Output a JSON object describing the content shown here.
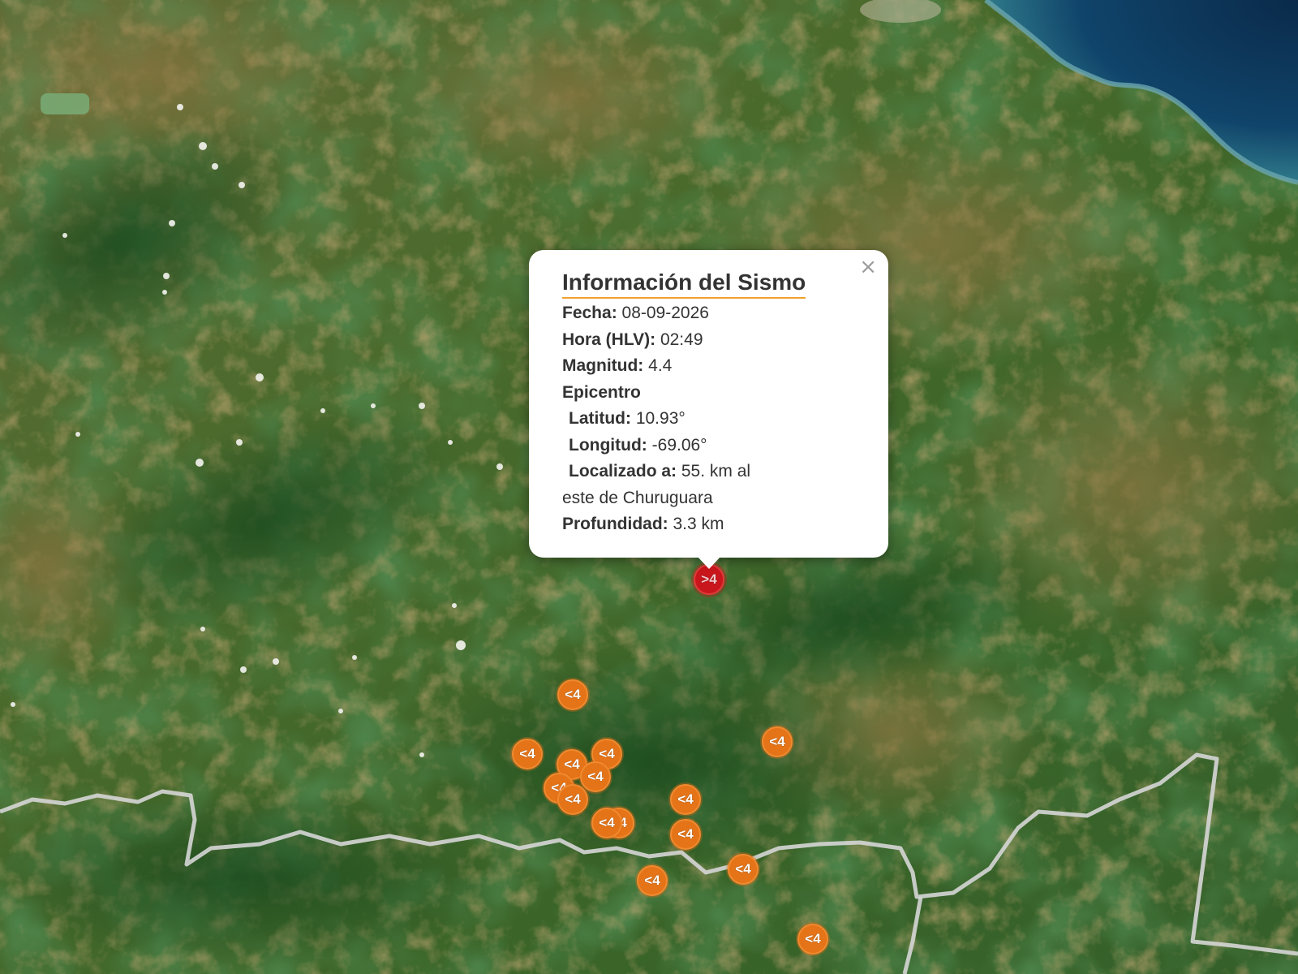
{
  "popup": {
    "title": "Información del Sismo",
    "close_symbol": "×",
    "fecha_label": "Fecha:",
    "fecha": "08-09-2026",
    "hora_label": "Hora (HLV):",
    "hora": "02:49",
    "magnitud_label": "Magnitud:",
    "magnitud": "4.4",
    "epicentro_label": "Epicentro",
    "latitud_label": "Latitud:",
    "latitud": "10.93°",
    "longitud_label": "Longitud:",
    "longitud": "-69.06°",
    "localizado_label": "Localizado a:",
    "localizado_1": "55. km al",
    "localizado_2": "este de Churuguara",
    "profundidad_label": "Profundidad:",
    "profundidad": "3.3 km"
  },
  "markers": {
    "large_label": ">4",
    "small_label": "<4",
    "small_color": "#e57418",
    "large_color": "#c8161c"
  },
  "map_colors": {
    "vegetation_dark": "#1f4a20",
    "vegetation_mid": "#3c6a2c",
    "dry_land": "#7a6a3a",
    "sea": "#0d3a5c",
    "border_line": "#d8d8d8"
  }
}
